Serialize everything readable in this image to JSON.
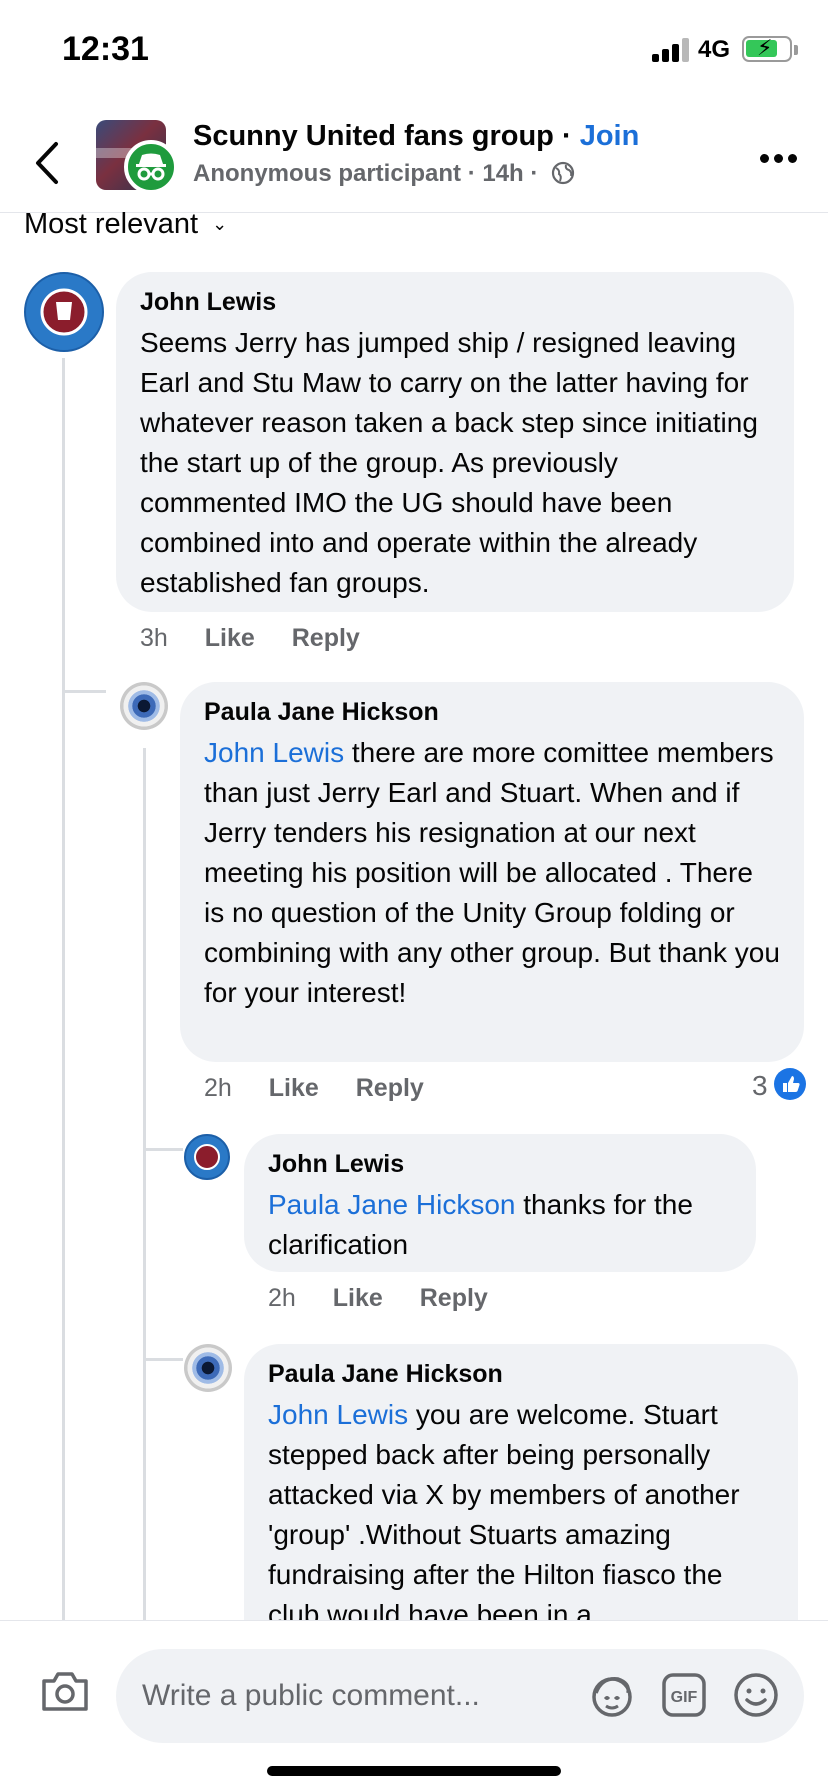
{
  "status_bar": {
    "time": "12:31",
    "network": "4G"
  },
  "header": {
    "group_name": "Scunny United fans group",
    "separator": " · ",
    "join_label": "Join",
    "participant": "Anonymous participant",
    "meta_sep": " · ",
    "post_age": "14h",
    "meta_sep2": " · "
  },
  "sort": {
    "label": "Most relevant"
  },
  "comments": [
    {
      "author": "John Lewis",
      "mention": "",
      "text": "Seems Jerry has jumped ship / resigned leaving Earl and Stu Maw to carry on the latter having for whatever reason taken a back step since initiating the start up of the group. As previously commented IMO the UG should have been combined into and operate within the already established fan groups.",
      "time": "3h",
      "like": "Like",
      "reply": "Reply"
    },
    {
      "author": "Paula Jane Hickson",
      "mention": "John Lewis",
      "text": " there are more comittee members than just Jerry Earl and Stuart. When and if Jerry tenders his resignation at our next meeting his position will be allocated . There is no question of the Unity Group folding or combining with any other group. But thank you for your interest!",
      "time": "2h",
      "like": "Like",
      "reply": "Reply",
      "reaction_count": "3"
    },
    {
      "author": "John Lewis",
      "mention": "Paula Jane Hickson",
      "text": " thanks for the clarification",
      "time": "2h",
      "like": "Like",
      "reply": "Reply"
    },
    {
      "author": "Paula Jane Hickson",
      "mention": "John Lewis",
      "text": " you are welcome. Stuart stepped back after being personally attacked via X by members of another 'group' .Without Stuarts amazing fundraising after the Hilton fiasco the club would have been in a"
    }
  ],
  "composer": {
    "placeholder": "Write a public comment..."
  },
  "icons": {
    "back": "chevron-left-icon",
    "more": "more-horizontal-icon",
    "camera": "camera-icon",
    "avatar_sticker": "avatar-sticker-icon",
    "gif": "gif-icon",
    "emoji": "emoji-icon"
  },
  "colors": {
    "link": "#1b6fd8",
    "bubble": "#f0f2f5",
    "like": "#1b74e4",
    "anon_badge": "#1f9b3d"
  }
}
